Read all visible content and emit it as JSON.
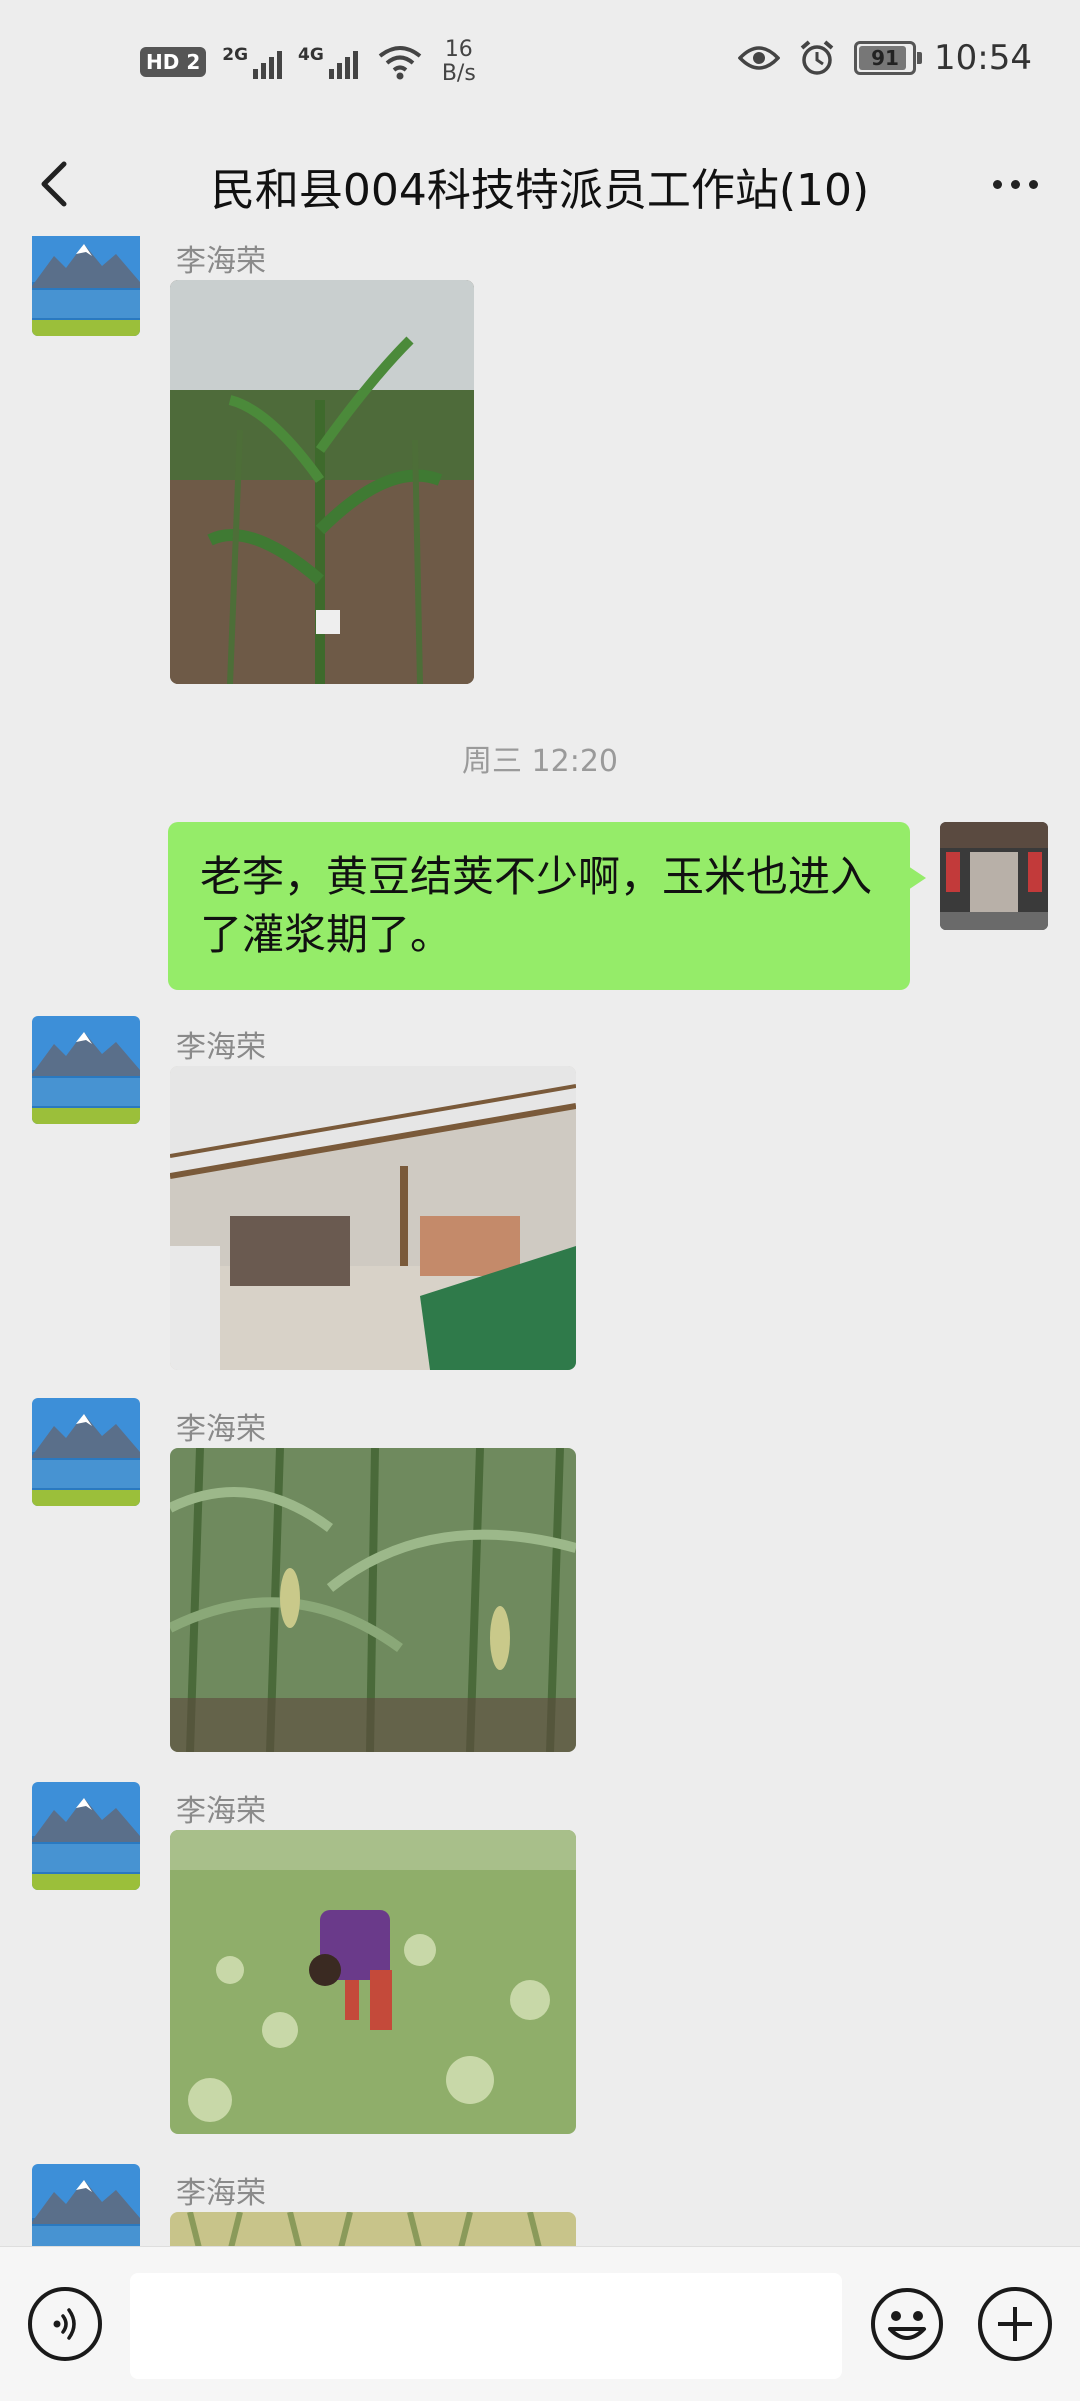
{
  "status_bar": {
    "hd": "HD",
    "sim": "2",
    "net1": "2G",
    "net2": "4G",
    "speed_value": "16",
    "speed_unit": "B/s",
    "battery": "91",
    "battery_level_percent": 91,
    "time": "10:54"
  },
  "header": {
    "title": "民和县004科技特派员工作站(10)"
  },
  "messages": [
    {
      "sender": "李海荣",
      "type": "image",
      "image": "corn-field-photo"
    },
    {
      "type": "timestamp",
      "text": "周三 12:20"
    },
    {
      "type": "text",
      "from_self": true,
      "text": "老李，黄豆结荚不少啊，玉米也进入了灌浆期了。"
    },
    {
      "sender": "李海荣",
      "type": "image",
      "image": "shed-store-photo"
    },
    {
      "sender": "李海荣",
      "type": "image",
      "image": "cornfield-ears-photo"
    },
    {
      "sender": "李海荣",
      "type": "image",
      "image": "cabbage-field-photo"
    },
    {
      "sender": "李海荣",
      "type": "image",
      "image": "crop-field-photo"
    }
  ],
  "input_bar": {
    "placeholder": ""
  },
  "colors": {
    "background": "#ededed",
    "bubble_self": "#95ec69",
    "input_bar": "#f6f6f6"
  }
}
